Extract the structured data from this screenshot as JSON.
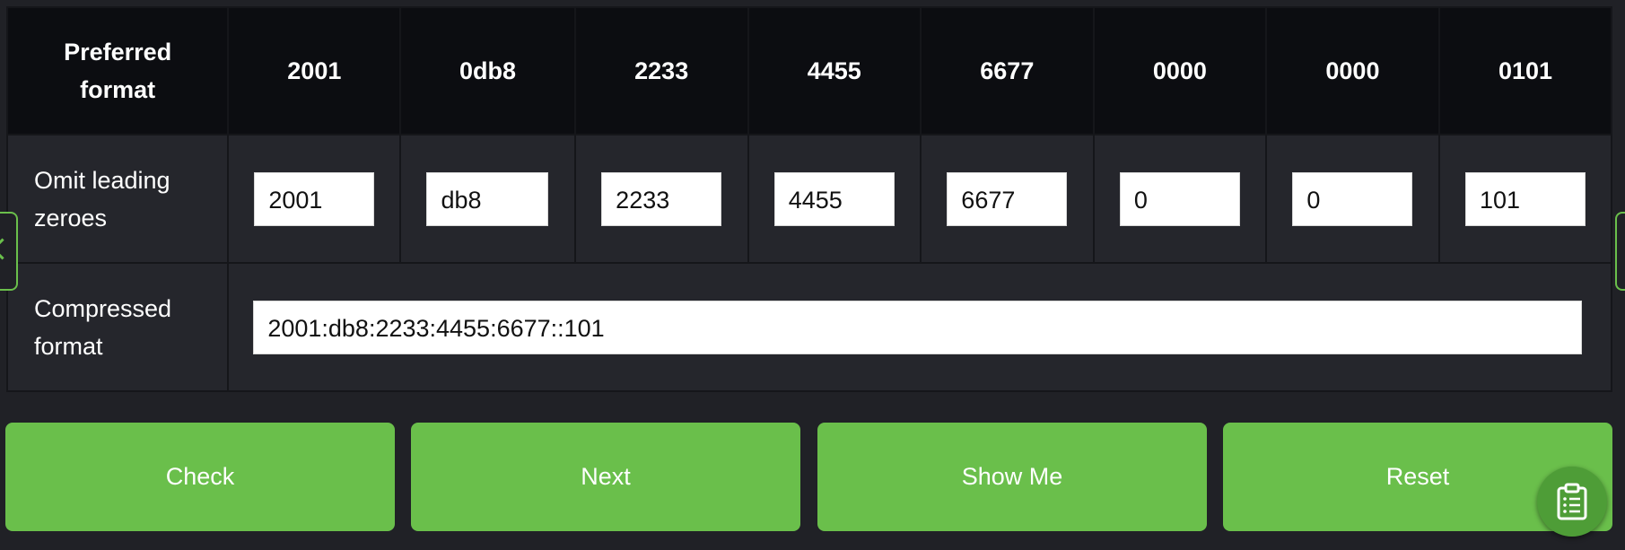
{
  "table": {
    "header": {
      "label_line1": "Preferred",
      "label_line2": "format",
      "hextets": [
        "2001",
        "0db8",
        "2233",
        "4455",
        "6677",
        "0000",
        "0000",
        "0101"
      ]
    },
    "omit_row": {
      "label_line1": "Omit leading",
      "label_line2": "zeroes",
      "values": [
        "2001",
        "db8",
        "2233",
        "4455",
        "6677",
        "0",
        "0",
        "101"
      ]
    },
    "compressed_row": {
      "label_line1": "Compressed",
      "label_line2": "format",
      "value": "2001:db8:2233:4455:6677::101"
    }
  },
  "buttons": {
    "check": "Check",
    "next": "Next",
    "show_me": "Show Me",
    "reset": "Reset"
  },
  "icons": {
    "prev": "chevron-left-icon",
    "next": "chevron-right-icon",
    "notes": "clipboard-icon"
  },
  "colors": {
    "accent": "#6abf4b",
    "background": "#202126",
    "header_bg": "#0c0d11"
  }
}
